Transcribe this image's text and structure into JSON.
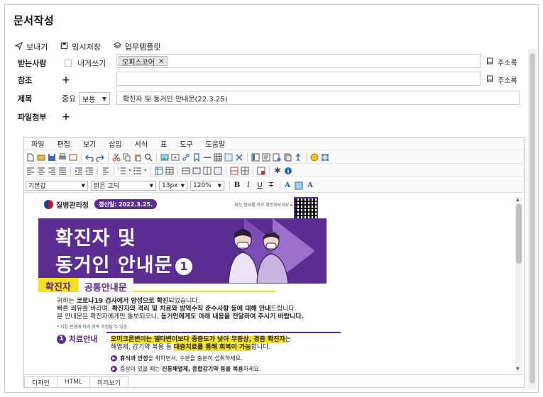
{
  "page": {
    "title": "문서작성"
  },
  "actions": [
    {
      "name": "send-button",
      "icon": "send-icon",
      "label": "보내기"
    },
    {
      "name": "save-draft-button",
      "icon": "save-icon",
      "label": "임시저장"
    },
    {
      "name": "template-button",
      "icon": "layers-icon",
      "label": "업무템플릿"
    }
  ],
  "form": {
    "recipient": {
      "label": "받는사람",
      "self_label": "내게쓰기",
      "chip": "오피스코어",
      "address_book": "주소록"
    },
    "cc": {
      "label": "참조",
      "address_book": "주소록"
    },
    "subject": {
      "label": "제목",
      "importance_label": "중요",
      "importance_value": "보통",
      "value": "확진자 및 동거인 안내문(22.3.25)"
    },
    "attachment": {
      "label": "파일첨부"
    }
  },
  "editor": {
    "menu": [
      "파일",
      "편집",
      "보기",
      "삽입",
      "서식",
      "표",
      "도구",
      "도움말"
    ],
    "format": {
      "paragraph": "기본값",
      "font": "맑은 고딕",
      "size": "13px",
      "zoom": "120%"
    },
    "tabs": [
      {
        "label": "디자인",
        "active": true
      },
      {
        "label": "HTML",
        "active": false
      },
      {
        "label": "미리보기",
        "active": false
      }
    ]
  },
  "poster": {
    "agency": "질병관리청",
    "updated": "갱신일: 2022.3.25.",
    "qr_note": "최신 정보를 바로 확인해보세요 ▸",
    "title_line1": "확진자 및",
    "title_line2": "동거인 안내문",
    "title_num": "1",
    "tag_a": "확진자",
    "tag_b": "공통안내문",
    "intro1_pre": "귀하는 ",
    "intro1_b1": "코로나19 검사에서 양성으로 확진",
    "intro1_post": "되었습니다.",
    "intro2_pre": "빠른 쾌유를 바라며, ",
    "intro2_b": "확진자의 격리 및 치료와 방역수칙 준수사항 등에 대해 안내",
    "intro2_post": "드립니다.",
    "intro3_pre": "본 안내문은 확진자에게만 통보되오니, ",
    "intro3_b": "동거인에게도 아래 내용을 전달하여 주시기 바랍니다.",
    "note": "* 지침 변경에 따라 항목 조정될 수 있음",
    "section_num": "1",
    "section_title": "치료안내",
    "sec1_hl1": "오미크론변이는 델타변이보다 중증도가 낮아 무증상, 경증 확진자",
    "sec1_post": "는",
    "sec2_pre": "해열제, 감기약 복용 등 ",
    "sec2_hl": "대증치료를 통해 회복이 가능",
    "sec2_post": "합니다.",
    "b1_pre": "휴식과 안정",
    "b1_post": "을 취하면서, 수분을 충분히 섭취하세요.",
    "b2_pre": "증상이 있을 때는 ",
    "b2_b": "진통해열제, 종합감기약 등을 복용",
    "b2_post": "하세요."
  }
}
